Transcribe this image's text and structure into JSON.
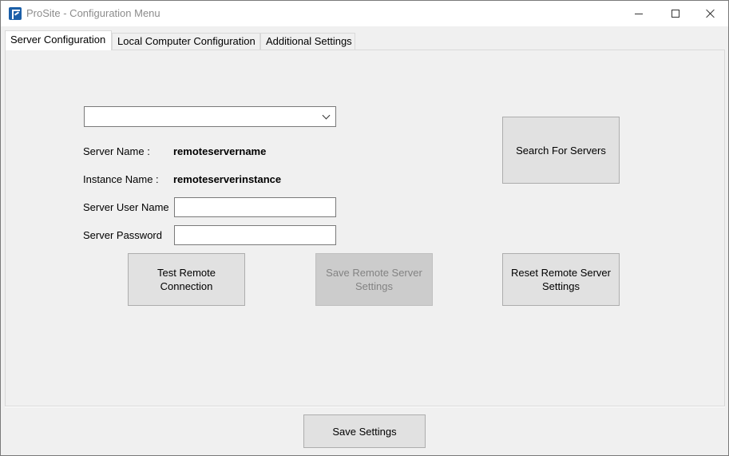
{
  "window": {
    "title": "ProSite - Configuration Menu",
    "icon": "prosite-app-icon"
  },
  "tabs": [
    {
      "label": "Server Configuration",
      "active": true
    },
    {
      "label": "Local Computer Configuration",
      "active": false
    },
    {
      "label": "Additional Settings",
      "active": false
    }
  ],
  "server": {
    "dropdown_value": "",
    "server_name_label": "Server Name :",
    "server_name_value": "remoteservername",
    "instance_name_label": "Instance Name :",
    "instance_name_value": "remoteserverinstance",
    "user_name_label": "Server User Name",
    "user_name_value": "",
    "password_label": "Server Password",
    "password_value": ""
  },
  "buttons": {
    "search": "Search For Servers",
    "test_line1": "Test Remote",
    "test_line2": "Connection",
    "save_remote_line1": "Save Remote Server",
    "save_remote_line2": "Settings",
    "reset_remote_line1": "Reset Remote Server",
    "reset_remote_line2": "Settings",
    "save_settings": "Save Settings"
  }
}
